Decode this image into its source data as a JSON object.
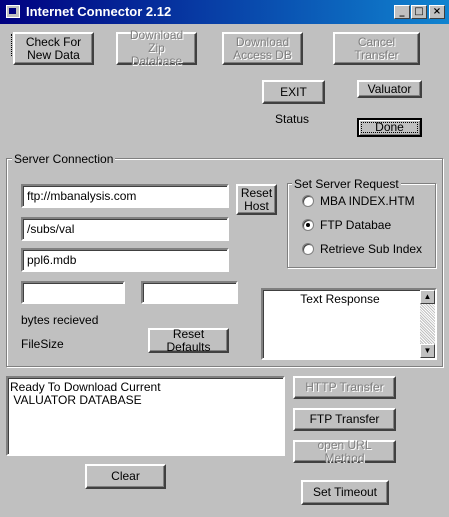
{
  "window": {
    "title": "Internet Connector 2.12",
    "minimize": "_",
    "maximize": "□",
    "close": "×"
  },
  "toolbar": {
    "check_new": "Check For\nNew Data",
    "download_zip": "Download Zip\nDatabase",
    "download_access": "Download\nAccess DB",
    "cancel_transfer": "Cancel Transfer",
    "exit": "EXIT",
    "valuator": "Valuator",
    "status": "Status",
    "done": "Done"
  },
  "server": {
    "group_label": "Server Connection",
    "host": "ftp://mbanalysis.com",
    "path": "/subs/val",
    "file": "ppl6.mdb",
    "bytes_field": "",
    "size_field": "",
    "reset_host": "Reset\nHost",
    "bytes_label": "bytes recieved",
    "filesize_label": "FileSize",
    "reset_defaults": "Reset Defaults"
  },
  "request": {
    "group_label": "Set Server Request",
    "options": [
      "MBA INDEX.HTM",
      "FTP Databae",
      "Retrieve Sub Index"
    ],
    "selected": "FTP Databae"
  },
  "response": {
    "text": "Text Response"
  },
  "log": {
    "text": "Ready To Download Current\n VALUATOR DATABASE"
  },
  "actions": {
    "http_transfer": "HTTP Transfer",
    "ftp_transfer": "FTP Transfer",
    "open_url": "open URL Method",
    "clear": "Clear",
    "set_timeout": "Set Timeout"
  }
}
